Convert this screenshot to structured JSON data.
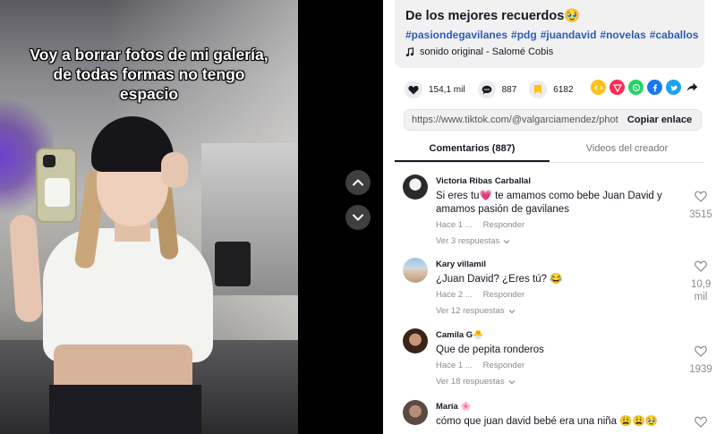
{
  "video": {
    "caption_line1": "Voy a borrar fotos de mi galería,",
    "caption_line2": "de todas formas no tengo",
    "caption_line3": "espacio"
  },
  "post": {
    "title": "De los mejores recuerdos🥹",
    "hashtags": [
      "#pasiondegavilanes",
      "#pdg",
      "#juandavid",
      "#novelas",
      "#caballos"
    ],
    "music": "sonido original - Salomé Cobis"
  },
  "stats": {
    "likes": "154,1 mil",
    "comments": "887",
    "saves": "6182"
  },
  "share": {
    "icons": [
      "embed-icon",
      "send-icon",
      "whatsapp-icon",
      "facebook-icon",
      "twitter-icon",
      "share-arrow-icon"
    ],
    "colors": [
      "#fcc21b",
      "#fe2c55",
      "#25d366",
      "#1877f2",
      "#1da1f2",
      "#161823"
    ]
  },
  "link": {
    "url": "https://www.tiktok.com/@valgarciamendez/phot...",
    "copy_label": "Copiar enlace"
  },
  "tabs": [
    {
      "label": "Comentarios (887)",
      "active": true
    },
    {
      "label": "Videos del creador",
      "active": false
    }
  ],
  "comments": [
    {
      "user": "Victoria Ribas Carballal",
      "text": "Si eres tu💗 te amamos como bebe Juan David y amamos pasión de gavilanes",
      "time": "Hace 1 ...",
      "reply": "Responder",
      "more": "Ver 3 respuestas",
      "likes": "3515"
    },
    {
      "user": "Kary villamil",
      "text": "¿Juan David? ¿Eres tú? 😂",
      "time": "Hace 2 ...",
      "reply": "Responder",
      "more": "Ver 12 respuestas",
      "likes": "10,9 mil"
    },
    {
      "user": "Camila G🐣",
      "text": "Que de pepita ronderos",
      "time": "Hace 1 ...",
      "reply": "Responder",
      "more": "Ver 18 respuestas",
      "likes": "1939"
    },
    {
      "user": "María 🌸",
      "text": "cómo que juan david bebé era una niña 😩😩🥹",
      "time": "",
      "reply": "",
      "more": "",
      "likes": ""
    }
  ]
}
